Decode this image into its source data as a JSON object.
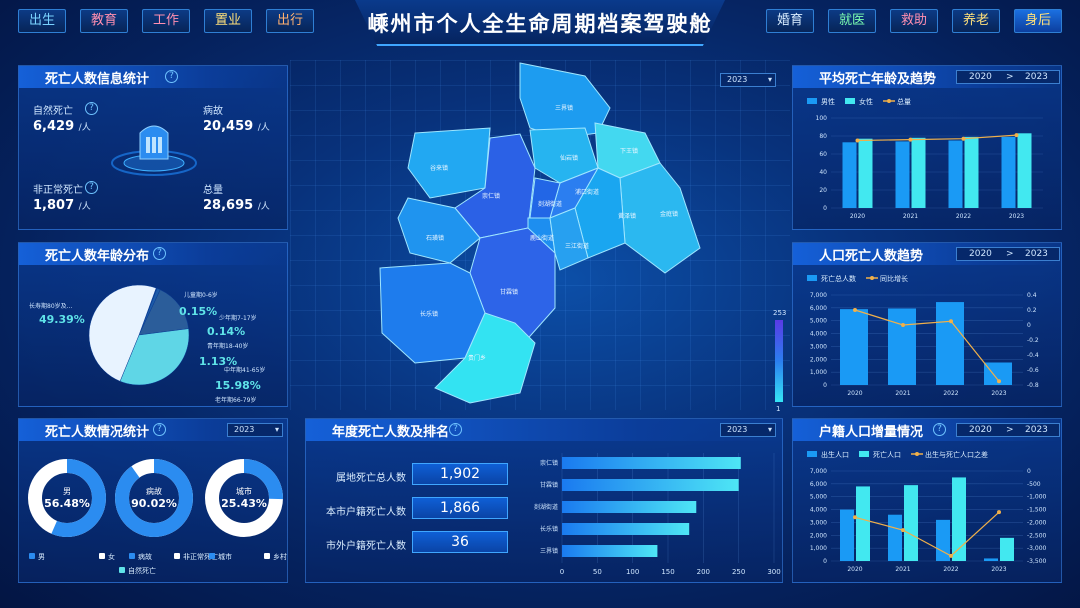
{
  "header": {
    "title": "嵊州市个人全生命周期档案驾驶舱",
    "nav_left": [
      "出生",
      "教育",
      "工作",
      "置业",
      "出行"
    ],
    "nav_right": [
      "婚育",
      "就医",
      "救助",
      "养老",
      "身后"
    ],
    "nav_left_colors": [
      "#7ad3ff",
      "#ff8fb0",
      "#ff8fb0",
      "#ffe07a",
      "#ffb070"
    ],
    "nav_right_colors": [
      "#d8ecff",
      "#7dffb0",
      "#ff8fb0",
      "#ffe07a",
      "#ffe07a"
    ]
  },
  "death_info": {
    "title": "死亡人数信息统计",
    "natural_label": "自然死亡",
    "natural_value": "6,429",
    "disease_label": "病故",
    "disease_value": "20,459",
    "abnormal_label": "非正常死亡",
    "abnormal_value": "1,807",
    "total_label": "总量",
    "total_value": "28,695",
    "unit": "/人"
  },
  "age_dist": {
    "title": "死亡人数年龄分布",
    "slices": [
      {
        "name": "儿童期0-6岁",
        "pct": "0.15",
        "value": 0.15
      },
      {
        "name": "少年期7-17岁",
        "pct": "0.14",
        "value": 0.14
      },
      {
        "name": "青年期18-40岁",
        "pct": "1.13",
        "value": 1.13
      },
      {
        "name": "中年期41-65岁",
        "pct": "15.98",
        "value": 15.98
      },
      {
        "name": "老年期66-79岁",
        "pct": "33.22",
        "value": 33.22
      },
      {
        "name": "长寿期80岁及...",
        "pct": "49.39",
        "value": 49.39
      }
    ],
    "colors": [
      "#8fc9ff",
      "#3a86e6",
      "#1c5aa8",
      "#2b5d9a",
      "#5fd6e6",
      "#e8f3ff"
    ],
    "pct_suffix": "%"
  },
  "death_status": {
    "title": "死亡人数情况统计",
    "year": "2023",
    "donuts": [
      {
        "label": "男",
        "pct": "56.48%",
        "value": 56.48,
        "color": "#2b8cf0"
      },
      {
        "label": "病故",
        "pct": "90.02%",
        "value": 90.02,
        "color": "#2b8cf0"
      },
      {
        "label": "城市",
        "pct": "25.43%",
        "value": 25.43,
        "color": "#2b8cf0"
      }
    ],
    "legend": [
      {
        "label": "男",
        "color": "#2b8cf0"
      },
      {
        "label": "女",
        "color": "#ffffff"
      },
      {
        "label": "病故",
        "color": "#2b8cf0"
      },
      {
        "label": "非正常死亡",
        "color": "#ffffff"
      },
      {
        "label": "城市",
        "color": "#2b8cf0"
      },
      {
        "label": "乡村",
        "color": "#ffffff"
      },
      {
        "label": "自然死亡",
        "color": "#5fe3e8"
      }
    ]
  },
  "annual_rank": {
    "title": "年度死亡人数及排名",
    "year": "2023",
    "rows": [
      {
        "label": "属地死亡总人数",
        "value": "1,902"
      },
      {
        "label": "本市户籍死亡人数",
        "value": "1,866"
      },
      {
        "label": "市外户籍死亡人数",
        "value": "36"
      }
    ]
  },
  "map": {
    "year": "2023",
    "legend_max": "253",
    "legend_min": "1",
    "regions": [
      "三界镇",
      "谷来镇",
      "下王镇",
      "仙岩镇",
      "浦口街道",
      "黄泽镇",
      "金庭镇",
      "崇仁镇",
      "剡湖街道",
      "鹿山街道",
      "三江街道",
      "石璜镇",
      "长乐镇",
      "甘霖镇",
      "贵门乡",
      "北漳镇",
      "通源乡"
    ]
  },
  "chart_data": [
    {
      "id": "avg_age",
      "title": "平均死亡年龄及趋势",
      "range": [
        "2020",
        ">",
        "2023"
      ],
      "type": "bar",
      "categories": [
        "2020",
        "2021",
        "2022",
        "2023"
      ],
      "series": [
        {
          "name": "男性",
          "type": "bar",
          "values": [
            73,
            74,
            75,
            79
          ],
          "color": "#1a9af5"
        },
        {
          "name": "女性",
          "type": "bar",
          "values": [
            77,
            78,
            79,
            83
          ],
          "color": "#42e8f0"
        },
        {
          "name": "总量",
          "type": "line",
          "values": [
            75,
            76,
            77,
            81
          ],
          "color": "#f0b04a"
        }
      ],
      "y_ticks": [
        "0",
        "20",
        "40",
        "60",
        "80",
        "100"
      ],
      "ylim": [
        0,
        100
      ]
    },
    {
      "id": "pop_death_trend",
      "title": "人口死亡人数趋势",
      "range": [
        "2020",
        ">",
        "2023"
      ],
      "type": "bar",
      "categories": [
        "2020",
        "2021",
        "2022",
        "2023"
      ],
      "series": [
        {
          "name": "死亡总人数",
          "type": "bar",
          "values": [
            5900,
            5950,
            6450,
            1750
          ],
          "color": "#1a9af5"
        },
        {
          "name": "同比增长",
          "type": "line",
          "values": [
            0.2,
            0.0,
            0.05,
            -0.75
          ],
          "color": "#f0b04a"
        }
      ],
      "y_ticks": [
        "0",
        "1,000",
        "2,000",
        "3,000",
        "4,000",
        "5,000",
        "6,000",
        "7,000"
      ],
      "y2_ticks": [
        "0.4",
        "0.2",
        "0",
        "-0.2",
        "-0.4",
        "-0.6",
        "-0.8"
      ],
      "ylim": [
        0,
        7000
      ],
      "y2lim": [
        -0.8,
        0.4
      ]
    },
    {
      "id": "household_growth",
      "title": "户籍人口增量情况",
      "range": [
        "2020",
        ">",
        "2023"
      ],
      "type": "bar",
      "categories": [
        "2020",
        "2021",
        "2022",
        "2023"
      ],
      "series": [
        {
          "name": "出生人口",
          "type": "bar",
          "values": [
            4000,
            3600,
            3200,
            200
          ],
          "color": "#1a9af5"
        },
        {
          "name": "死亡人口",
          "type": "bar",
          "values": [
            5800,
            5900,
            6500,
            1800
          ],
          "color": "#42e8f0"
        },
        {
          "name": "出生与死亡人口之差",
          "type": "line",
          "values": [
            -1800,
            -2300,
            -3300,
            -1600
          ],
          "color": "#f0b04a"
        }
      ],
      "y_ticks": [
        "0",
        "1,000",
        "2,000",
        "3,000",
        "4,000",
        "5,000",
        "6,000",
        "7,000"
      ],
      "y2_ticks": [
        "0",
        "-500",
        "-1,000",
        "-1,500",
        "-2,000",
        "-2,500",
        "-3,000",
        "-3,500"
      ],
      "ylim": [
        0,
        7000
      ],
      "y2lim": [
        -3500,
        0
      ]
    },
    {
      "id": "town_rank",
      "type": "bar",
      "orientation": "horizontal",
      "categories": [
        "崇仁镇",
        "甘霖镇",
        "剡湖街道",
        "长乐镇",
        "三界镇"
      ],
      "values": [
        253,
        250,
        190,
        180,
        135
      ],
      "x_ticks": [
        "0",
        "50",
        "100",
        "150",
        "200",
        "250",
        "300"
      ],
      "xlim": [
        0,
        300
      ]
    }
  ]
}
